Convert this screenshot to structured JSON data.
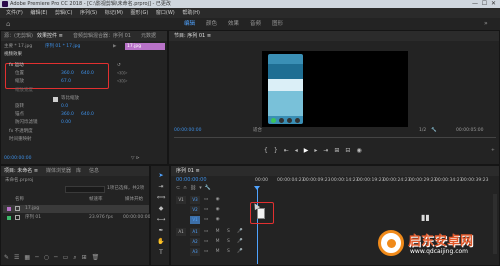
{
  "window": {
    "title": "Adobe Premiere Pro CC 2018 - [C:\\影视剪辑\\未命名.prproj] - 已更改"
  },
  "menu": [
    "文件(F)",
    "编辑(E)",
    "剪辑(C)",
    "序列(S)",
    "标记(M)",
    "图形(G)",
    "窗口(W)",
    "帮助(H)"
  ],
  "workspaces": {
    "items": [
      "编辑",
      "颜色",
      "效果",
      "音频",
      "图形"
    ],
    "active": "编辑"
  },
  "effect_controls": {
    "tabs": [
      "源：(无剪辑)",
      "效果控件 ≡",
      "音频剪辑混合器：序列 01",
      "元数据"
    ],
    "source_row": "主要 * 17.jpg",
    "seq_link": "序列 01 * 17.jpg",
    "section_video": "视频效果",
    "fx_motion": "fx 运动",
    "position_label": "位置",
    "position_x": "360.0",
    "position_y": "640.0",
    "scale_label": "缩放",
    "scale_value": "67.0",
    "scale_width_label": "缩放宽度",
    "uniform_scale_label": "等比缩放",
    "rotation_label": "旋转",
    "rotation_value": "0.0",
    "anchor_label": "锚点",
    "anchor_x": "360.0",
    "anchor_y": "640.0",
    "flicker_label": "防闪烁滤镜",
    "flicker_value": "0.00",
    "opacity_label": "fx 不透明度",
    "time_remap_label": "时间重映射",
    "clip_name": "17.jpg",
    "timecode": "00:00:00:00"
  },
  "program_monitor": {
    "title": "节目: 序列 01 ≡",
    "timecode": "00:00:00:00",
    "fit": "适合",
    "ratio": "1/2",
    "duration": "00:00:05:00"
  },
  "project": {
    "tabs": [
      "项目: 未命名 ≡",
      "媒体浏览器",
      "库",
      "信息"
    ],
    "file": "未命名.prproj",
    "search_placeholder": "",
    "count": "1项已选择，共2项",
    "col_name": "名称",
    "col_fps": "帧速率",
    "col_start": "媒体开始",
    "items": [
      {
        "name": "17.jpg",
        "fps": "",
        "start": ""
      },
      {
        "name": "序列 01",
        "fps": "23.976 fps",
        "start": "00:00:00:00"
      }
    ]
  },
  "timeline": {
    "title": "序列 01 ≡",
    "timecode": "00:00:00:00",
    "ruler": [
      "00:00",
      "00:00:04:23",
      "00:00:09:23",
      "00:00:14:23",
      "00:00:19:23",
      "00:00:24:23",
      "00:00:29:23",
      "00:00:34:23",
      "00:00:39:23"
    ],
    "tracks": [
      "V3",
      "V2",
      "V1",
      "A1",
      "A2",
      "A3"
    ]
  },
  "watermark": {
    "text": "启东安卓网",
    "url": "www.qdcaijing.com"
  },
  "colors": {
    "accent": "#3d8fe6",
    "highlight": "#e23030",
    "clip": "#b872c8",
    "watermark_orange": "#f08a1a"
  }
}
